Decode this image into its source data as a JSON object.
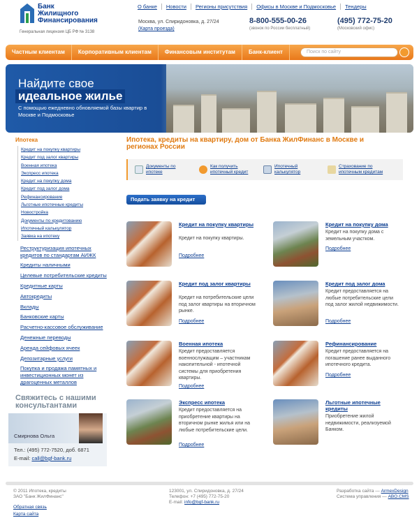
{
  "logo": {
    "line1": "Банк",
    "line2": "Жилищного",
    "line3": "Финансирования",
    "license": "Генеральная лицензия ЦБ РФ № 3138"
  },
  "topnav": [
    "О банке",
    "Новости",
    "Регионы присутствия",
    "Офисы в Москве и Подмосковье",
    "Тендеры"
  ],
  "address": {
    "line": "Москва, ул. Спиридоновка, д. 27/24",
    "map": "(Карта проезда)"
  },
  "phones": [
    {
      "num": "8-800-555-00-26",
      "note": "(звонок по России бесплатный)"
    },
    {
      "num": "(495) 772-75-20",
      "note": "(Московский офис)"
    }
  ],
  "menu": [
    "Частным клиентам",
    "Корпоративным клиентам",
    "Финансовым институтам",
    "Банк-клиент"
  ],
  "search": {
    "placeholder": "Поиск по сайту"
  },
  "banner": {
    "h1": "Найдите свое",
    "h2": "идеальное жилье",
    "sub": "С помощью ежедневно обновляемой базы квартир в Москве и Подмосковье"
  },
  "sidebar": {
    "heading": "Ипотека",
    "sub": [
      "Кредит на покупку квартиры",
      "Кредит под залог квартиры",
      "Военная ипотека",
      "Экспресс ипотека",
      "Кредит на покупку дома",
      "Кредит под залог дома",
      "Рефинансирование",
      "Льготные ипотечные кредиты",
      "Новостройка",
      "Документы по кредитованию",
      "Ипотечный калькулятор",
      "Заявка на ипотеку"
    ],
    "main": [
      "Реструктуризация ипотечных кредитов по стандартам АИЖК",
      "Кредиты наличными",
      "Целевые потребительские кредиты",
      "Кредитные карты",
      "Автокредиты",
      "Вклады",
      "Банковские карты",
      "Расчетно-кассовое обслуживание",
      "Денежные переводы",
      "Аренда сейфовых ячеек",
      "Депозитарные услуги",
      "Покупка и продажа памятных и инвестиционных монет из драгоценных металлов"
    ]
  },
  "contact": {
    "heading": "Свяжитесь с нашими консультантами",
    "name": "Смирнова Ольга",
    "tel_label": "Тел.:",
    "tel": "(495) 772-7520, доб. 6871",
    "email_label": "E-mail:",
    "email": "call@bgf-bank.ru"
  },
  "main": {
    "title": "Ипотека, кредиты на квартиру, дом от Банка ЖилФинанс в Москве и регионах России",
    "toolbar": [
      "Документы по ипотеке",
      "Как получить ипотечный кредит",
      "Ипотечный калькулятор",
      "Страхование по ипотечным кредитам"
    ],
    "apply": "Подать заявку на кредит",
    "more": "Подробнее",
    "cards": [
      {
        "title": "Кредит на покупку квартиры",
        "desc": "Кредит на покупку квартиры."
      },
      {
        "title": "Кредит на покупку дома",
        "desc": "Кредит на покупку дома с земельным участком."
      },
      {
        "title": "Кредит под залог квартиры",
        "desc": "Кредит на потребительские цели под залог квартиры на вторичном рынке."
      },
      {
        "title": "Кредит под залог дома",
        "desc": "Кредит предоставляется на любые потребительские цели под залог жилой недвижимости."
      },
      {
        "title": "Военная ипотека",
        "desc": "Кредит предоставляется военнослужащим – участникам накопительной - ипотечной системы для приобретения квартиры."
      },
      {
        "title": "Рефинансирование",
        "desc": "Кредит предоставляется на погашение ранее выданного ипотечного кредита."
      },
      {
        "title": "Экспресс ипотека",
        "desc": "Кредит предоставляется на приобретение квартиры на вторичном рынке жилья или на любые потребительские цели."
      },
      {
        "title": "Льготные ипотечные кредиты",
        "desc": "Приобретение жилой недвижимости, реализуемой Банком."
      }
    ]
  },
  "footer": {
    "copy1": "© 2011 Ипотека, кредиты",
    "copy2": "ЗАО \"Банк ЖилФинанс\"",
    "feedback": "Обратная связь",
    "sitemap": "Карта сайта",
    "addr1": "123001, ул. Спиридоновка, д. 27/24",
    "addr2": "Телефон: +7 (495) 772-75-20",
    "email_label": "E-mail:",
    "email": "info@bgf-bank.ru",
    "dev_label": "Разработка сайта —",
    "dev": "ArmexDesign",
    "cms_label": "Система управления —",
    "cms": "ABO.CMS"
  }
}
